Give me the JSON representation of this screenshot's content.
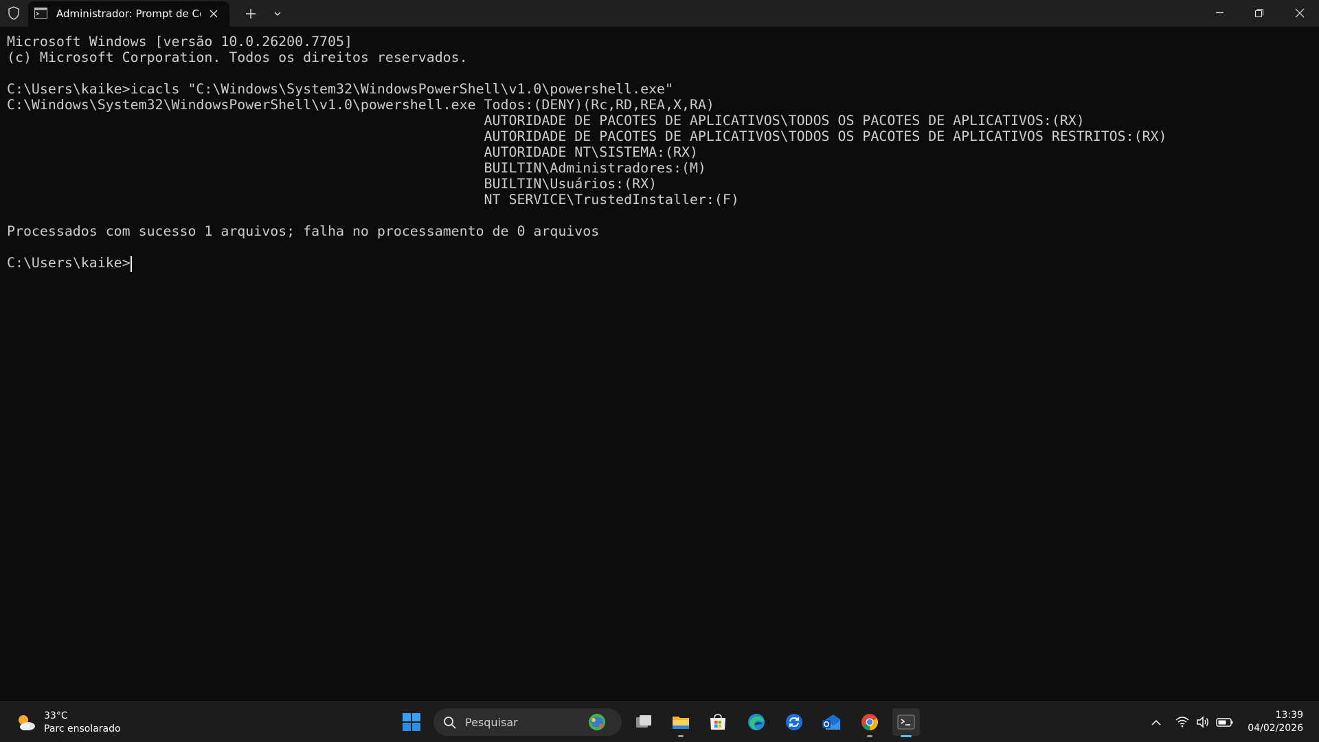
{
  "window": {
    "tab_title": "Administrador: Prompt de Co"
  },
  "terminal": {
    "lines": [
      "Microsoft Windows [versão 10.0.26200.7705]",
      "(c) Microsoft Corporation. Todos os direitos reservados.",
      "",
      "C:\\Users\\kaike>icacls \"C:\\Windows\\System32\\WindowsPowerShell\\v1.0\\powershell.exe\"",
      "C:\\Windows\\System32\\WindowsPowerShell\\v1.0\\powershell.exe Todos:(DENY)(Rc,RD,REA,X,RA)",
      "                                                          AUTORIDADE DE PACOTES DE APLICATIVOS\\TODOS OS PACOTES DE APLICATIVOS:(RX)",
      "                                                          AUTORIDADE DE PACOTES DE APLICATIVOS\\TODOS OS PACOTES DE APLICATIVOS RESTRITOS:(RX)",
      "                                                          AUTORIDADE NT\\SISTEMA:(RX)",
      "                                                          BUILTIN\\Administradores:(M)",
      "                                                          BUILTIN\\Usuários:(RX)",
      "                                                          NT SERVICE\\TrustedInstaller:(F)",
      "",
      "Processados com sucesso 1 arquivos; falha no processamento de 0 arquivos",
      "",
      "C:\\Users\\kaike>"
    ]
  },
  "taskbar": {
    "weather": {
      "temperature": "33°C",
      "description": "Parc ensolarado"
    },
    "search": {
      "label": "Pesquisar"
    },
    "clock": {
      "time": "13:39",
      "date": "04/02/2026"
    }
  },
  "icons": {
    "titlebar": [
      "shield-icon",
      "terminal-icon",
      "close-icon",
      "plus-icon",
      "chevron-down-icon",
      "minimize-icon",
      "restore-icon",
      "close-icon"
    ],
    "taskbar_apps": [
      "windows-start-icon",
      "task-view-icon",
      "file-explorer-icon",
      "microsoft-store-icon",
      "edge-icon",
      "sync-app-icon",
      "outlook-icon",
      "chrome-icon",
      "terminal-icon"
    ],
    "tray": [
      "chevron-up-icon",
      "wifi-icon",
      "volume-icon",
      "battery-icon"
    ]
  },
  "colors": {
    "terminal_bg": "#0c0c0c",
    "terminal_text": "#cccccc",
    "titlebar_bg": "#202020",
    "taskbar_bg": "#1c1c1c"
  }
}
